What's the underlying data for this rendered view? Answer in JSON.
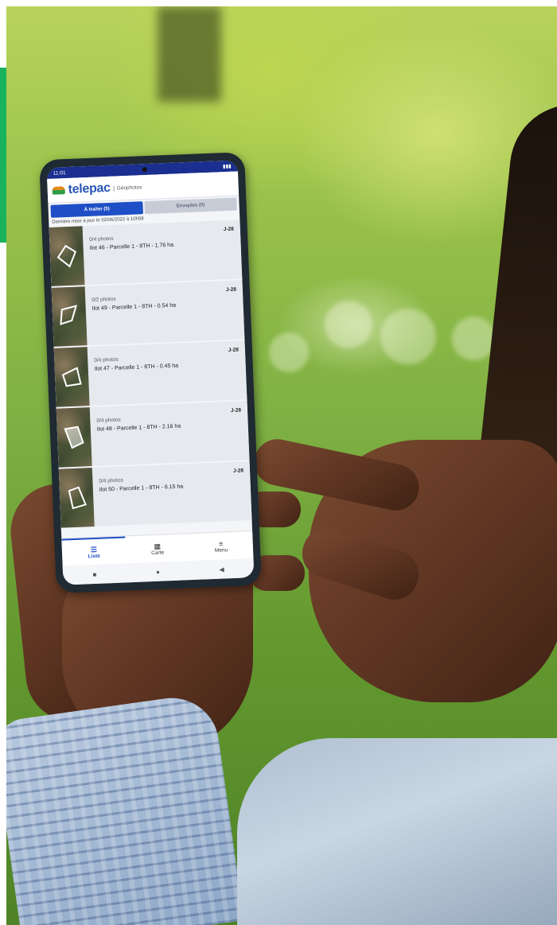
{
  "app": {
    "name": "telepac",
    "subtitle": "Géophotos",
    "status_time": "11:01"
  },
  "tabs": [
    {
      "label": "À traiter (5)"
    },
    {
      "label": "Envoyées (0)"
    }
  ],
  "last_update": "Dernière mise à jour le 02/06/2022 à 10h58",
  "items": [
    {
      "photos": "0/4 photos",
      "parcel": "Ilot 46 - Parcelle 1 - 8TH - 1.76 ha",
      "deadline": "J-28"
    },
    {
      "photos": "0/2 photos",
      "parcel": "Ilot 49 - Parcelle 1 - 8TH - 0.54 ha",
      "deadline": "J-28"
    },
    {
      "photos": "0/4 photos",
      "parcel": "Ilot 47 - Parcelle 1 - 8TH - 0.45 ha",
      "deadline": "J-28"
    },
    {
      "photos": "0/4 photos",
      "parcel": "Ilot 48 - Parcelle 1 - 8TH - 2.16 ha",
      "deadline": "J-28"
    },
    {
      "photos": "0/4 photos",
      "parcel": "Ilot 50 - Parcelle 1 - 8TH - 6.15 ha",
      "deadline": "J-28"
    }
  ],
  "bottom_nav": [
    {
      "label": "Liste",
      "icon": "list-icon"
    },
    {
      "label": "Carte",
      "icon": "map-icon"
    },
    {
      "label": "Menu",
      "icon": "hamburger-icon"
    }
  ],
  "colors": {
    "accent_bar": "#19b35e",
    "app_primary": "#1f4fc6"
  }
}
